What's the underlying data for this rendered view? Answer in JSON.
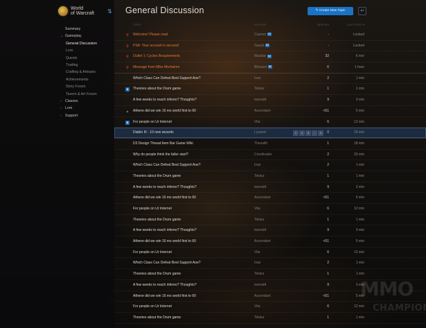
{
  "app": {
    "logo_line1": "World",
    "logo_line2": "of Warcraft"
  },
  "colors": {
    "accent": "#1a73c5",
    "sticky": "#e8752e",
    "background": "#0d0c0b"
  },
  "sidebar": {
    "items": [
      {
        "label": "Summary",
        "level": "top"
      },
      {
        "label": "Gameplay",
        "level": "group",
        "caret": "⌄"
      },
      {
        "label": "General Discussion",
        "level": "sub",
        "active": true
      },
      {
        "label": "Lore",
        "level": "sub"
      },
      {
        "label": "Quests",
        "level": "sub"
      },
      {
        "label": "Trading",
        "level": "sub"
      },
      {
        "label": "Crafting & Artisans",
        "level": "sub"
      },
      {
        "label": "Achievements",
        "level": "sub"
      },
      {
        "label": "Story Forum",
        "level": "sub"
      },
      {
        "label": "Tavern & Art Forum",
        "level": "sub"
      },
      {
        "label": "Classes",
        "level": "group",
        "caret": "›"
      },
      {
        "label": "Lore",
        "level": "group",
        "caret": "›"
      },
      {
        "label": "Support",
        "level": "group",
        "caret": "›"
      }
    ]
  },
  "header": {
    "title": "General Discussion",
    "create_label": "✎ Create New Topic",
    "settings_icon": "↩"
  },
  "table": {
    "columns": {
      "topic": "Topic",
      "author": "Author",
      "replies": "Replies",
      "last_post": "Last Post ▾"
    },
    "rows": [
      {
        "icon": "sticky",
        "subject": "Welcome! Please read",
        "author": "Cazeon",
        "blizz": true,
        "replies": "-",
        "last": "Locked"
      },
      {
        "icon": "sticky",
        "subject": "PSA: Your account is secured",
        "author": "Gazyk",
        "blizz": true,
        "replies": "-",
        "last": "Locked"
      },
      {
        "icon": "sticky",
        "subject": "Outlet 1: Cycles Requirements",
        "author": "Wazbar",
        "blizz": true,
        "replies": "32",
        "last": "6 min"
      },
      {
        "icon": "sticky",
        "subject": "Message from Mike Morhaime",
        "author": "Blizzard",
        "blizz": true,
        "replies": "6",
        "last": "1 hour",
        "group_break": true
      },
      {
        "icon": "",
        "subject": "Which Class Can Defeat Best Support Aoe?",
        "author": "Ivan",
        "blizz": false,
        "replies": "2",
        "last": "1 min"
      },
      {
        "icon": "blizz",
        "subject": "Theories about the Drum game",
        "author": "Tekkur",
        "blizz": false,
        "replies": "1",
        "last": "1 min"
      },
      {
        "icon": "",
        "subject": "A few weeks to reach inferno? Thoughts?",
        "author": "iwerskA",
        "blizz": false,
        "replies": "9",
        "last": "3 min"
      },
      {
        "icon": "up",
        "subject": "Athene did we win 16 ms world first to 60",
        "author": "Ascendant",
        "blizz": false,
        "replies": "<51",
        "last": "5 min"
      },
      {
        "icon": "blizz",
        "subject": "For people on Ur Internet",
        "author": "Vita",
        "blizz": false,
        "replies": "6",
        "last": "12 min"
      },
      {
        "icon": "",
        "subject": "Diablo III - 10 new wizards",
        "author": "Lysandr",
        "blizz": false,
        "replies": "0",
        "last": "16 min",
        "selected": true,
        "pager": [
          "1",
          "2",
          "3",
          "..",
          "4"
        ]
      },
      {
        "icon": "",
        "subject": "D3 Design Thread Item Bar Game Wiki",
        "author": "Thexaith",
        "blizz": false,
        "replies": "1",
        "last": "18 min"
      },
      {
        "icon": "",
        "subject": "Why do people think the faller start?",
        "author": "Crestleader",
        "blizz": false,
        "replies": "2",
        "last": "20 min"
      },
      {
        "icon": "",
        "subject": "Which Class Can Defeat Best Support Aoe?",
        "author": "Ivan",
        "blizz": false,
        "replies": "2",
        "last": "1 min"
      },
      {
        "icon": "",
        "subject": "Theories about the Drum game",
        "author": "Tekkur",
        "blizz": false,
        "replies": "1",
        "last": "1 min"
      },
      {
        "icon": "",
        "subject": "A few weeks to reach inferno? Thoughts?",
        "author": "iwerskA",
        "blizz": false,
        "replies": "9",
        "last": "3 min"
      },
      {
        "icon": "",
        "subject": "Athene did we win 16 ms world first to 60",
        "author": "Ascendant",
        "blizz": false,
        "replies": "<51",
        "last": "5 min"
      },
      {
        "icon": "",
        "subject": "For people on Ur Internet",
        "author": "Vita",
        "blizz": false,
        "replies": "6",
        "last": "12 min"
      },
      {
        "icon": "",
        "subject": "Theories about the Drum game",
        "author": "Tekkur",
        "blizz": false,
        "replies": "1",
        "last": "1 min"
      },
      {
        "icon": "",
        "subject": "A few weeks to reach inferno? Thoughts?",
        "author": "iwerskA",
        "blizz": false,
        "replies": "9",
        "last": "3 min"
      },
      {
        "icon": "",
        "subject": "Athene did we win 16 ms world first to 60",
        "author": "Ascendant",
        "blizz": false,
        "replies": "<51",
        "last": "5 min"
      },
      {
        "icon": "",
        "subject": "For people on Ur Internet",
        "author": "Vita",
        "blizz": false,
        "replies": "6",
        "last": "12 min"
      },
      {
        "icon": "",
        "subject": "Which Class Can Defeat Best Support Aoe?",
        "author": "Ivan",
        "blizz": false,
        "replies": "2",
        "last": "1 min"
      },
      {
        "icon": "",
        "subject": "Theories about the Drum game",
        "author": "Tekkur",
        "blizz": false,
        "replies": "1",
        "last": "1 min"
      },
      {
        "icon": "",
        "subject": "A few weeks to reach inferno? Thoughts?",
        "author": "iwerskA",
        "blizz": false,
        "replies": "9",
        "last": "3 min"
      },
      {
        "icon": "",
        "subject": "Athene did we win 16 ms world first to 60",
        "author": "Ascendant",
        "blizz": false,
        "replies": "<51",
        "last": "5 min"
      },
      {
        "icon": "",
        "subject": "For people on Ur Internet",
        "author": "Vita",
        "blizz": false,
        "replies": "6",
        "last": "12 min"
      },
      {
        "icon": "",
        "subject": "Theories about the Drum game",
        "author": "Tekkur",
        "blizz": false,
        "replies": "1",
        "last": "1 min"
      }
    ]
  },
  "watermark": {
    "line1": "MMO",
    "line2": "CHAMPION"
  }
}
